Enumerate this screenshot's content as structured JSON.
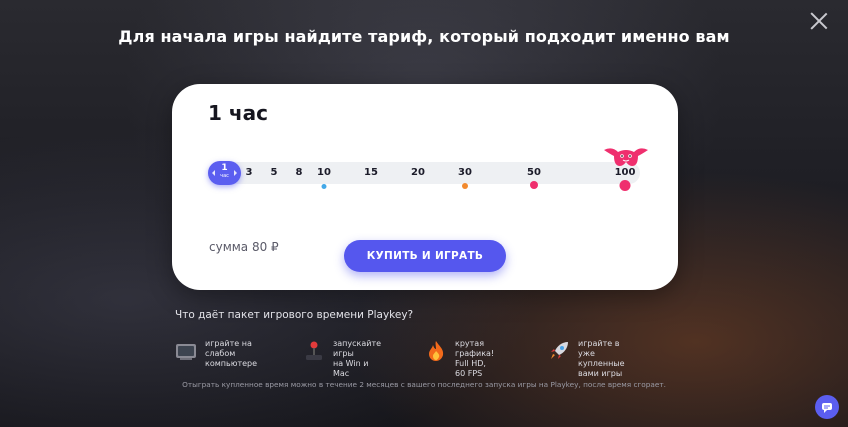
{
  "headline": "Для начала игры найдите тариф, который подходит именно вам",
  "card": {
    "title": "1 час",
    "slider": {
      "selected_value": "1",
      "selected_unit": "час",
      "ticks": [
        "3",
        "5",
        "8",
        "10",
        "15",
        "20",
        "30",
        "50",
        "100"
      ]
    },
    "sum_label": "сумма 80 ₽",
    "buy_label": "КУПИТЬ И ИГРАТЬ"
  },
  "question": "Что даёт пакет игрового времени Playkey?",
  "features": [
    {
      "icon": "tv-icon",
      "text": "играйте на слабом\nкомпьютере"
    },
    {
      "icon": "joystick-icon",
      "text": "запускайте игры\nна Win и Mac"
    },
    {
      "icon": "fire-icon",
      "text": "крутая графика!\nFull HD, 60 FPS"
    },
    {
      "icon": "rocket-icon",
      "text": "играйте в уже\nкупленные вами игры"
    }
  ],
  "footnote": "Отыграть купленное время можно в течение 2 месяцев с вашего последнего запуска игры на Playkey, после время сгорает.",
  "colors": {
    "accent": "#5b5ef0",
    "dot_blue": "#43a8e8",
    "dot_orange": "#f28a2e",
    "dot_pink": "#ef2f6e"
  }
}
